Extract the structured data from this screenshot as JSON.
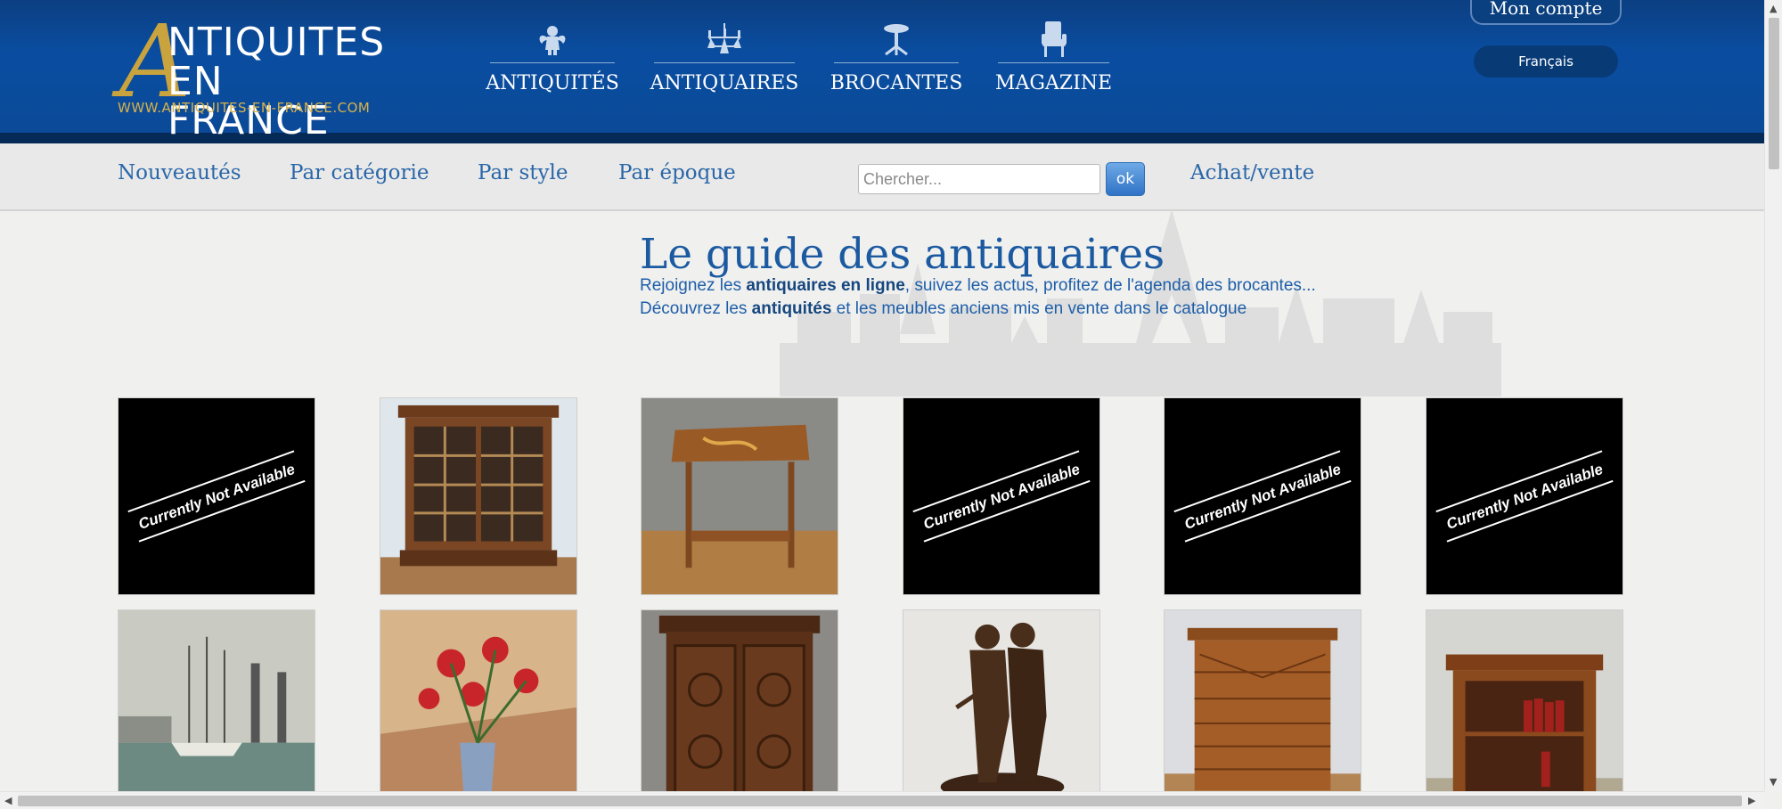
{
  "logo": {
    "letter": "A",
    "line1": "NTIQUITES",
    "line2": "EN FRANCE",
    "url": "WWW.ANTIQUITES-EN-FRANCE.COM"
  },
  "main_nav": [
    {
      "label": "ANTIQUITÉS",
      "icon": "cherub-icon"
    },
    {
      "label": "ANTIQUAIRES",
      "icon": "chandelier-icon"
    },
    {
      "label": "BROCANTES",
      "icon": "pedestal-table-icon"
    },
    {
      "label": "MAGAZINE",
      "icon": "armchair-icon"
    }
  ],
  "account": {
    "label": "Mon compte",
    "language": "Français"
  },
  "subnav": {
    "links": [
      "Nouveautés",
      "Par catégorie",
      "Par style",
      "Par époque"
    ],
    "search_placeholder": "Chercher...",
    "search_button": "ok",
    "buy_sell": "Achat/vente"
  },
  "hero": {
    "title": "Le guide des antiquaires",
    "line1_pre": "Rejoignez les ",
    "line1_bold": "antiquaires en ligne",
    "line1_post": ", suivez les actus, profitez de l'agenda des brocantes...",
    "line2_pre": "Découvrez les ",
    "line2_bold": "antiquités",
    "line2_post": " et les meubles anciens mis en vente dans le catalogue"
  },
  "grid": {
    "unavailable_text": "Currently Not Available",
    "tiles": [
      {
        "kind": "unavailable"
      },
      {
        "kind": "bookcase"
      },
      {
        "kind": "side-table"
      },
      {
        "kind": "unavailable"
      },
      {
        "kind": "unavailable"
      },
      {
        "kind": "unavailable"
      },
      {
        "kind": "harbor-painting"
      },
      {
        "kind": "flowers-painting"
      },
      {
        "kind": "carved-cabinet"
      },
      {
        "kind": "bronze-soldiers"
      },
      {
        "kind": "chiffonier"
      },
      {
        "kind": "small-bookcase"
      }
    ]
  },
  "colors": {
    "header_blue": "#0a4da0",
    "header_border": "#062a57",
    "gold": "#c9a33e",
    "link_blue": "#2a67a8"
  }
}
